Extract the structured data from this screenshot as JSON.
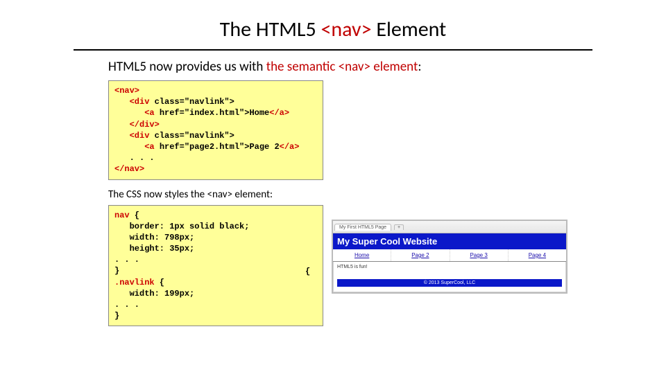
{
  "title": {
    "prefix": "The HTML5 ",
    "tag": "<nav>",
    "suffix": " Element"
  },
  "intro": {
    "prefix": "HTML5 now provides us with ",
    "highlight": "the semantic <nav> element",
    "suffix": ":"
  },
  "code1": {
    "l1a": "<nav>",
    "l2a": "   <div ",
    "l2b": "class=\"navlink\">",
    "l3a": "      <a ",
    "l3b": "href=\"index.html\">",
    "l3c": "Home",
    "l3d": "</a>",
    "l4a": "   </div>",
    "l5a": "   <div ",
    "l5b": "class=\"navlink\">",
    "l6a": "      <a ",
    "l6b": "href=\"page2.html\">",
    "l6c": "Page 2",
    "l6d": "</a>",
    "l7": "   . . .",
    "l8": "</nav>"
  },
  "subhead": "The CSS now styles the <nav> element:",
  "code2": {
    "l1a": "nav",
    "l1b": " {",
    "l2": "   border: 1px solid black;",
    "l3": "   width: 798px;",
    "l4": "   height: 35px;",
    "l5": ". . .",
    "l6": "}",
    "l7a": ".navlink",
    "l7b": " {",
    "l8": "   width: 199px;",
    "l9": ". . .",
    "l10": "}"
  },
  "hidden_fragment": "{",
  "preview": {
    "tab": "My First HTML5 Page",
    "tab_plus": "+",
    "banner": "My Super Cool Website",
    "nav": [
      "Home",
      "Page 2",
      "Page 3",
      "Page 4"
    ],
    "body": "HTML5 is fun!",
    "footer": "© 2013 SuperCool, LLC"
  }
}
